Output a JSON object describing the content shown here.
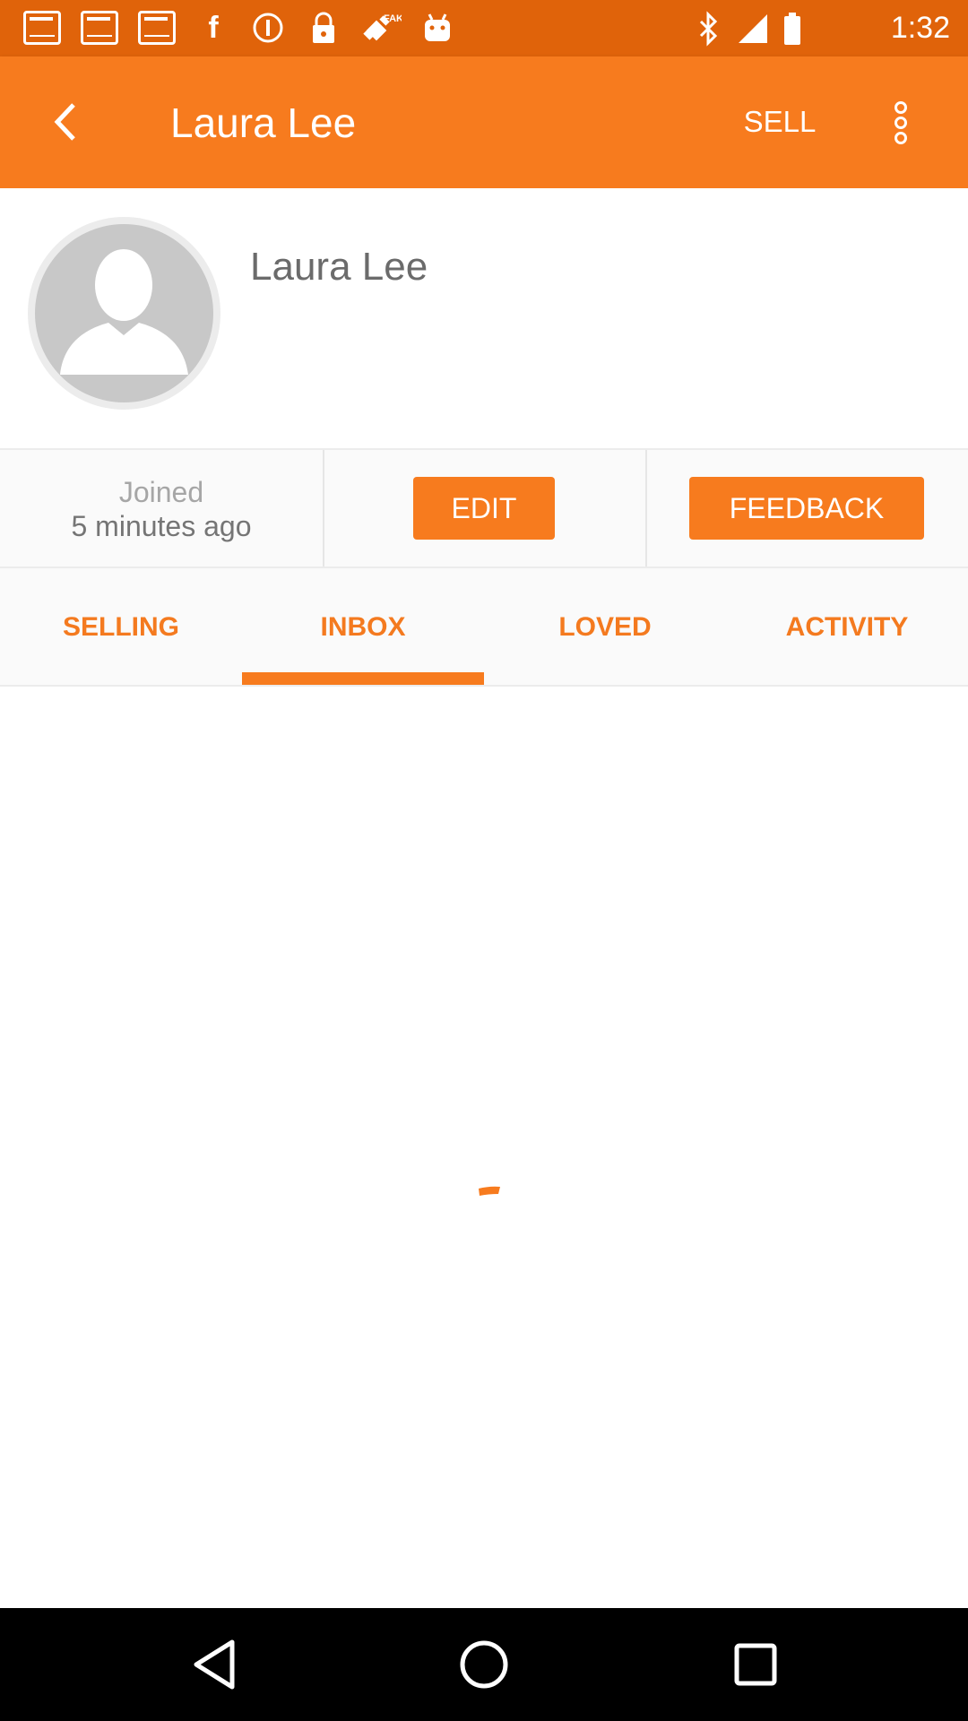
{
  "status_bar": {
    "time": "1:32",
    "icons": [
      "iifl-markets-icon",
      "iifl-markets-icon",
      "iifl-markets-icon",
      "facebook-icon",
      "info-icon",
      "lock-icon",
      "fake-gps-icon",
      "android-icon",
      "bluetooth-icon",
      "signal-icon",
      "battery-icon"
    ]
  },
  "app_bar": {
    "title": "Laura Lee",
    "sell_label": "SELL",
    "back_icon": "back-arrow-icon",
    "more_icon": "more-vertical-icon"
  },
  "profile": {
    "name": "Laura Lee",
    "avatar_icon": "default-avatar-icon",
    "joined_label": "Joined",
    "joined_time": "5 minutes ago",
    "edit_label": "EDIT",
    "feedback_label": "FEEDBACK"
  },
  "tabs": {
    "items": [
      {
        "label": "SELLING"
      },
      {
        "label": "INBOX"
      },
      {
        "label": "LOVED"
      },
      {
        "label": "ACTIVITY"
      }
    ],
    "selected": "INBOX"
  },
  "colors": {
    "status_bar": "#e0630a",
    "accent": "#f77b1e",
    "tab_text": "#f47a1f"
  }
}
